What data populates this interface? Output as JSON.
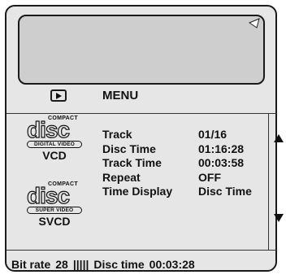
{
  "menu": {
    "title": "MENU"
  },
  "discs": [
    {
      "top_text": "COMPACT",
      "logo_text": "disc",
      "sub_label": "DIGITAL VIDEO",
      "format": "VCD"
    },
    {
      "top_text": "COMPACT",
      "logo_text": "disc",
      "sub_label": "SUPER VIDEO",
      "format": "SVCD"
    }
  ],
  "info": {
    "rows": [
      {
        "label": "Track",
        "value": "01/16"
      },
      {
        "label": "Disc Time",
        "value": "01:16:28"
      },
      {
        "label": "Track Time",
        "value": "00:03:58"
      },
      {
        "label": "Repeat",
        "value": "OFF"
      },
      {
        "label": "Time Display",
        "value": "Disc Time"
      }
    ]
  },
  "status_bar": {
    "bitrate_label": "Bit rate",
    "bitrate_value": "28",
    "meter": "|||||",
    "disc_time_label": "Disc time",
    "disc_time_value": "00:03:28"
  },
  "icons": {
    "play": "play-icon",
    "scroll_up": "triangle-up-icon",
    "scroll_down": "triangle-down-icon"
  }
}
